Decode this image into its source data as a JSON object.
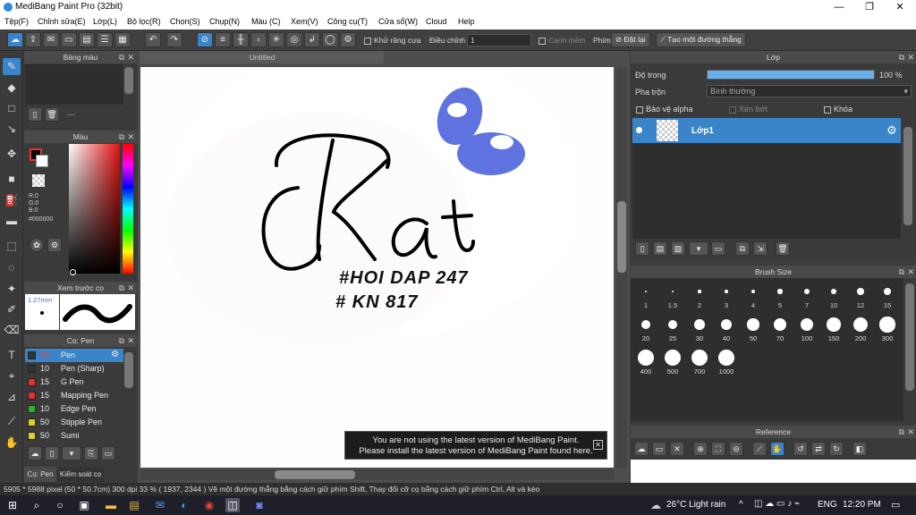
{
  "window": {
    "title": "MediBang Paint Pro (32bit)",
    "minimize": "—",
    "restore": "❐",
    "close": "✕"
  },
  "menu": [
    "Tệp(F)",
    "Chỉnh sửa(E)",
    "Lớp(L)",
    "Bộ lọc(R)",
    "Chọn(S)",
    "Chụp(N)",
    "Màu (C)",
    "Xem(V)",
    "Công cụ(T)",
    "Cửa sổ(W)",
    "Cloud",
    "Help"
  ],
  "toolbar": {
    "antialias_label": "Khử răng cưa",
    "adjust_label": "Điều chỉnh",
    "adjust_value": "1",
    "edge_label": "Cạnh mềm",
    "key_label": "Phím",
    "reset_label": "Đặt lại",
    "straight_line_label": "Tạo một đường thẳng"
  },
  "palette_panel": {
    "title": "Bảng màu",
    "dash": "---"
  },
  "color_panel": {
    "title": "Màu",
    "r": "R:0",
    "g": "G:0",
    "b": "B:0",
    "hex": "#000000",
    "fg_color": "#000000",
    "bg_color": "#ffffff"
  },
  "preview_panel": {
    "title": "Xem trước cọ",
    "size": "1.27mm"
  },
  "brush_panel": {
    "title": "Cọ: Pen",
    "brushes": [
      {
        "size": "15",
        "name": "Pen",
        "color": "#333333",
        "selected": true
      },
      {
        "size": "10",
        "name": "Pen (Sharp)",
        "color": "#333333"
      },
      {
        "size": "15",
        "name": "G Pen",
        "color": "#e03030"
      },
      {
        "size": "15",
        "name": "Mapping Pen",
        "color": "#e03030"
      },
      {
        "size": "10",
        "name": "Edge Pen",
        "color": "#30b030"
      },
      {
        "size": "50",
        "name": "Stipple Pen",
        "color": "#e0d020"
      },
      {
        "size": "50",
        "name": "Sumi",
        "color": "#e0d020"
      }
    ],
    "tab1": "Cọ: Pen",
    "tab2": "Kiểm soát cọ"
  },
  "document": {
    "tab": "Untitled",
    "text1": "#HOI DAP 247",
    "text2": "# KN 817"
  },
  "notice": {
    "line1": "You are not using the latest version of MediBang Paint.",
    "line2": "Please install the latest version of MediBang Paint found here."
  },
  "layer_panel": {
    "title": "Lớp",
    "opacity_label": "Độ trong",
    "opacity_value": "100 %",
    "opacity_fraction": 1.0,
    "blend_label": "Pha trộn",
    "blend_value": "Bình thường",
    "protect_alpha": "Bảo vệ alpha",
    "clip": "Xén bớt",
    "lock": "Khóa",
    "layer_name": "Lớp1"
  },
  "brushsize_panel": {
    "title": "Brush Size",
    "sizes": [
      "1",
      "1.5",
      "2",
      "3",
      "4",
      "5",
      "7",
      "10",
      "12",
      "15",
      "20",
      "25",
      "30",
      "40",
      "50",
      "70",
      "100",
      "150",
      "200",
      "300",
      "400",
      "500",
      "700",
      "1000"
    ]
  },
  "reference_panel": {
    "title": "Reference"
  },
  "status": "5905 * 5988 pixel  (50 * 50.7cm)  300 dpi  33 %  ( 1937, 2344 )  Vẽ một đường thẳng bằng cách giữ phím Shift, Thay đổi cỡ cọ bằng cách giữ phím Ctrl, Alt và kéo",
  "taskbar": {
    "weather": "26°C  Light rain",
    "lang": "ENG",
    "time": "12:20 PM"
  }
}
